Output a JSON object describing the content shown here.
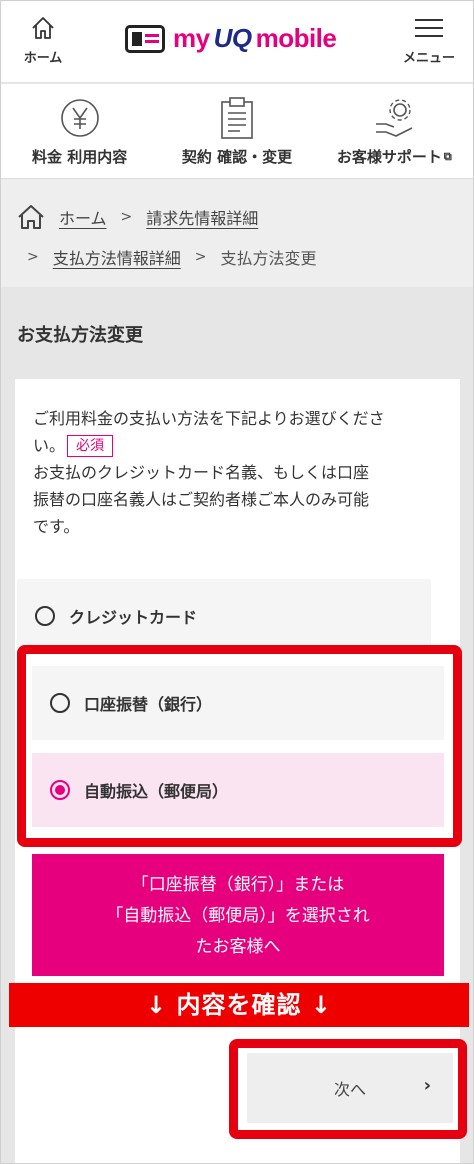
{
  "header": {
    "home_label": "ホーム",
    "logo_text_my": "my",
    "logo_text_uq": "UQ",
    "logo_text_mobile": "mobile",
    "menu_label": "メニュー"
  },
  "nav": [
    {
      "label": "料金 利用内容",
      "icon": "yen-icon"
    },
    {
      "label": "契約 確認・変更",
      "icon": "clipboard-icon"
    },
    {
      "label": "お客様サポート",
      "icon": "support-gear-icon"
    }
  ],
  "breadcrumb": {
    "home": "ホーム",
    "billing_detail": "請求先情報詳細",
    "payment_detail": "支払方法情報詳細",
    "current": "支払方法変更"
  },
  "page_title": "お支払方法変更",
  "intro": {
    "line1": "ご利用料金の支払い方法を下記よりお選びくださ",
    "line2": "い。",
    "required": "必須",
    "line3": "お支払のクレジットカード名義、もしくは口座",
    "line4": "振替の口座名義人はご契約者様ご本人のみ可能",
    "line5": "です。"
  },
  "options": [
    {
      "label": "クレジットカード",
      "selected": false
    },
    {
      "label": "口座振替（銀行）",
      "selected": false
    },
    {
      "label": "自動振込（郵便局）",
      "selected": true
    }
  ],
  "info_banner": {
    "line1": "「口座振替（銀行）」または",
    "line2": "「自動振込（郵便局）」を選択され",
    "line3": "たお客様へ"
  },
  "confirm_banner": "↓ 内容を確認 ↓",
  "next_button": "次へ",
  "colors": {
    "brand_pink": "#e6007e",
    "highlight_red": "#e6000f",
    "brand_navy": "#1d2a8a"
  }
}
